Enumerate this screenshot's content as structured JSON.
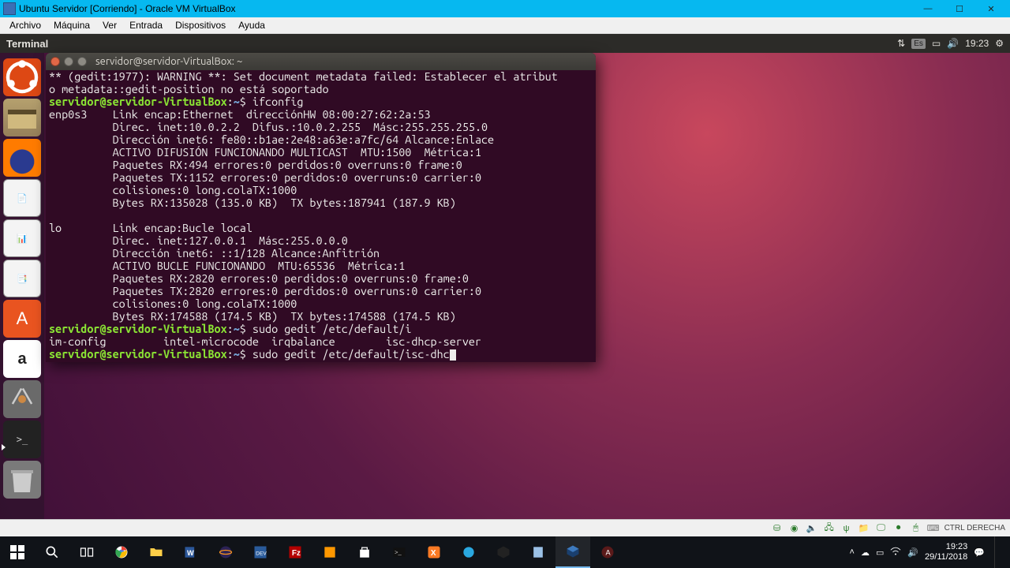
{
  "vbox": {
    "title": "Ubuntu Servidor [Corriendo] - Oracle VM VirtualBox",
    "menu": [
      "Archivo",
      "Máquina",
      "Ver",
      "Entrada",
      "Dispositivos",
      "Ayuda"
    ],
    "status_host_key": "CTRL DERECHA"
  },
  "ubuntu_top": {
    "app": "Terminal",
    "kbd_layout": "Es",
    "time": "19:23"
  },
  "launcher": {
    "items": [
      {
        "name": "dash",
        "label": "Ubuntu"
      },
      {
        "name": "files",
        "label": "Files"
      },
      {
        "name": "firefox",
        "label": "Firefox"
      },
      {
        "name": "writer",
        "label": "LibreOffice Writer"
      },
      {
        "name": "calc",
        "label": "LibreOffice Calc"
      },
      {
        "name": "impress",
        "label": "LibreOffice Impress"
      },
      {
        "name": "software",
        "label": "Ubuntu Software"
      },
      {
        "name": "amazon",
        "label": "Amazon"
      },
      {
        "name": "settings",
        "label": "System Settings"
      },
      {
        "name": "terminal",
        "label": "Terminal"
      },
      {
        "name": "trash",
        "label": "Trash"
      }
    ]
  },
  "terminal": {
    "title": "servidor@servidor-VirtualBox: ~",
    "prompt_user": "servidor@servidor-VirtualBox",
    "prompt_path": "~",
    "warning_line": "** (gedit:1977): WARNING **: Set document metadata failed: Establecer el atributo metadata::gedit-position no está soportado",
    "cmd1": "ifconfig",
    "ifconfig_output": "enp0s3    Link encap:Ethernet  direcciónHW 08:00:27:62:2a:53\n          Direc. inet:10.0.2.2  Difus.:10.0.2.255  Másc:255.255.255.0\n          Dirección inet6: fe80::b1ae:2e48:a63e:a7fc/64 Alcance:Enlace\n          ACTIVO DIFUSIÓN FUNCIONANDO MULTICAST  MTU:1500  Métrica:1\n          Paquetes RX:494 errores:0 perdidos:0 overruns:0 frame:0\n          Paquetes TX:1152 errores:0 perdidos:0 overruns:0 carrier:0\n          colisiones:0 long.colaTX:1000\n          Bytes RX:135028 (135.0 KB)  TX bytes:187941 (187.9 KB)\n\nlo        Link encap:Bucle local\n          Direc. inet:127.0.0.1  Másc:255.0.0.0\n          Dirección inet6: ::1/128 Alcance:Anfitrión\n          ACTIVO BUCLE FUNCIONANDO  MTU:65536  Métrica:1\n          Paquetes RX:2820 errores:0 perdidos:0 overruns:0 frame:0\n          Paquetes TX:2820 errores:0 perdidos:0 overruns:0 carrier:0\n          colisiones:0 long.colaTX:1000\n          Bytes RX:174588 (174.5 KB)  TX bytes:174588 (174.5 KB)\n",
    "cmd2": "sudo gedit /etc/default/i",
    "tab_completions": "im-config         intel-microcode  irqbalance        isc-dhcp-server",
    "cmd3": "sudo gedit /etc/default/isc-dhc"
  },
  "win_taskbar": {
    "clock_time": "19:23",
    "clock_date": "29/11/2018"
  }
}
